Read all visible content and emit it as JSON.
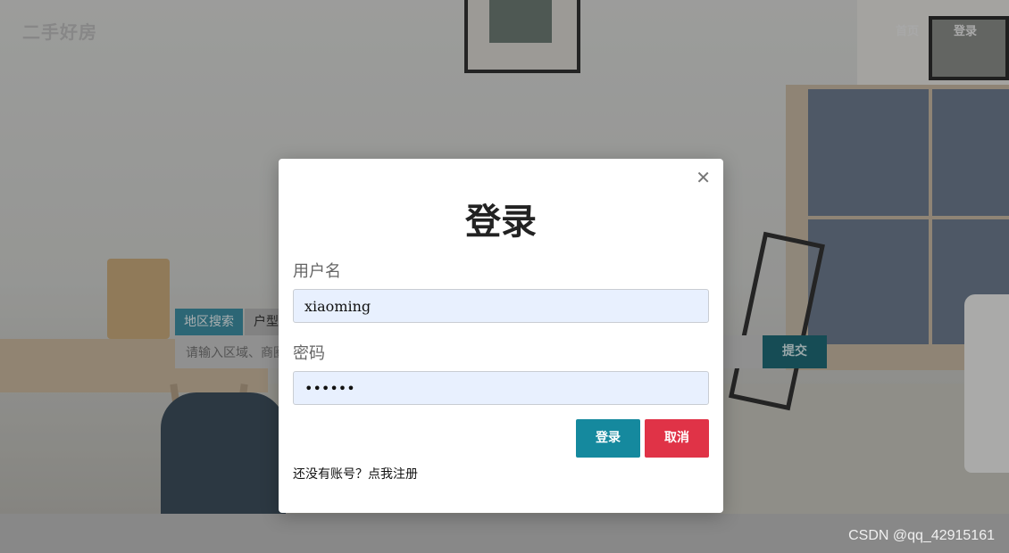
{
  "navbar": {
    "brand": "二手好房",
    "links": [
      "首页",
      "登录"
    ]
  },
  "search": {
    "tabs": [
      "地区搜索",
      "户型"
    ],
    "placeholder": "请输入区域、商圈",
    "submit_label": "提交"
  },
  "modal": {
    "title": "登录",
    "close_icon": "close-icon",
    "username_label": "用户名",
    "username_value": "xiaoming",
    "password_label": "密码",
    "password_value": "••••••",
    "login_button": "登录",
    "cancel_button": "取消",
    "register_text": "还没有账号？点我注册"
  },
  "colors": {
    "login_button": "#15899e",
    "cancel_button": "#e03347",
    "input_background": "#e8f0fe",
    "search_submit": "#1f6a77"
  },
  "watermark": "CSDN @qq_42915161"
}
